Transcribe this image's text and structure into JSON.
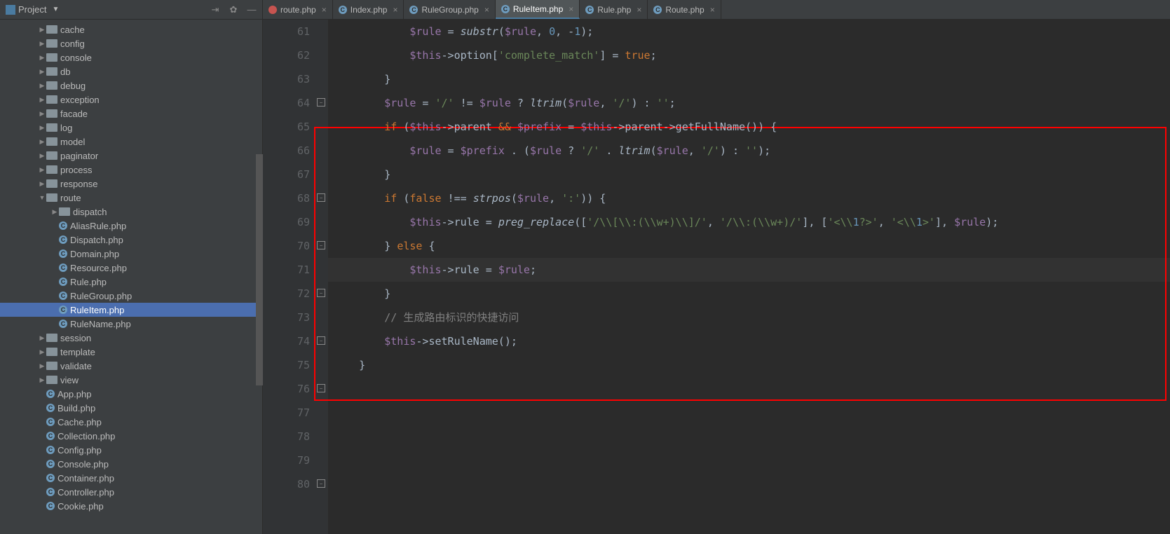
{
  "sidebar": {
    "title": "Project",
    "folders": [
      {
        "name": "cache",
        "level": 3,
        "open": false,
        "type": "folder"
      },
      {
        "name": "config",
        "level": 3,
        "open": false,
        "type": "folder"
      },
      {
        "name": "console",
        "level": 3,
        "open": false,
        "type": "folder"
      },
      {
        "name": "db",
        "level": 3,
        "open": false,
        "type": "folder"
      },
      {
        "name": "debug",
        "level": 3,
        "open": false,
        "type": "folder"
      },
      {
        "name": "exception",
        "level": 3,
        "open": false,
        "type": "folder"
      },
      {
        "name": "facade",
        "level": 3,
        "open": false,
        "type": "folder"
      },
      {
        "name": "log",
        "level": 3,
        "open": false,
        "type": "folder"
      },
      {
        "name": "model",
        "level": 3,
        "open": false,
        "type": "folder"
      },
      {
        "name": "paginator",
        "level": 3,
        "open": false,
        "type": "folder"
      },
      {
        "name": "process",
        "level": 3,
        "open": false,
        "type": "folder"
      },
      {
        "name": "response",
        "level": 3,
        "open": false,
        "type": "folder"
      },
      {
        "name": "route",
        "level": 3,
        "open": true,
        "type": "folder"
      },
      {
        "name": "dispatch",
        "level": 4,
        "open": false,
        "type": "folder"
      },
      {
        "name": "AliasRule.php",
        "level": 4,
        "type": "php"
      },
      {
        "name": "Dispatch.php",
        "level": 4,
        "type": "php"
      },
      {
        "name": "Domain.php",
        "level": 4,
        "type": "php"
      },
      {
        "name": "Resource.php",
        "level": 4,
        "type": "php"
      },
      {
        "name": "Rule.php",
        "level": 4,
        "type": "php"
      },
      {
        "name": "RuleGroup.php",
        "level": 4,
        "type": "php"
      },
      {
        "name": "RuleItem.php",
        "level": 4,
        "type": "php",
        "selected": true
      },
      {
        "name": "RuleName.php",
        "level": 4,
        "type": "php"
      },
      {
        "name": "session",
        "level": 3,
        "open": false,
        "type": "folder"
      },
      {
        "name": "template",
        "level": 3,
        "open": false,
        "type": "folder"
      },
      {
        "name": "validate",
        "level": 3,
        "open": false,
        "type": "folder"
      },
      {
        "name": "view",
        "level": 3,
        "open": false,
        "type": "folder"
      },
      {
        "name": "App.php",
        "level": 3,
        "type": "php"
      },
      {
        "name": "Build.php",
        "level": 3,
        "type": "php"
      },
      {
        "name": "Cache.php",
        "level": 3,
        "type": "php"
      },
      {
        "name": "Collection.php",
        "level": 3,
        "type": "php"
      },
      {
        "name": "Config.php",
        "level": 3,
        "type": "php"
      },
      {
        "name": "Console.php",
        "level": 3,
        "type": "php"
      },
      {
        "name": "Container.php",
        "level": 3,
        "type": "php"
      },
      {
        "name": "Controller.php",
        "level": 3,
        "type": "php"
      },
      {
        "name": "Cookie.php",
        "level": 3,
        "type": "php"
      }
    ]
  },
  "tabs": [
    {
      "name": "route.php",
      "active": false,
      "iconColor": "orange"
    },
    {
      "name": "Index.php",
      "active": false,
      "iconColor": "blue"
    },
    {
      "name": "RuleGroup.php",
      "active": false,
      "iconColor": "blue"
    },
    {
      "name": "RuleItem.php",
      "active": true,
      "iconColor": "blue"
    },
    {
      "name": "Rule.php",
      "active": false,
      "iconColor": "blue"
    },
    {
      "name": "Route.php",
      "active": false,
      "iconColor": "blue"
    }
  ],
  "code": {
    "startLine": 61,
    "lines": [
      "            $rule = substr($rule, 0, -1);",
      "",
      "            $this->option['complete_match'] = true;",
      "        }",
      "",
      "        $rule = '/' != $rule ? ltrim($rule, '/') : '';",
      "",
      "        if ($this->parent && $prefix = $this->parent->getFullName()) {",
      "            $rule = $prefix . ($rule ? '/' . ltrim($rule, '/') : '');",
      "        }",
      "",
      "        if (false !== strpos($rule, ':')) {",
      "            $this->rule = preg_replace(['/\\\\[\\\\:(\\\\w+)\\\\]/', '/\\\\:(\\\\w+)/'], ['<\\\\1?>', '<\\\\1>'], $rule);",
      "        } else {",
      "            $this->rule = $rule;",
      "        }",
      "",
      "        // 生成路由标识的快捷访问",
      "        $this->setRuleName();",
      "    }"
    ],
    "comment": "// 生成路由标识的快捷访问",
    "currentLine": 71,
    "highlightBox": {
      "startLine": 66,
      "endLine": 76
    }
  }
}
